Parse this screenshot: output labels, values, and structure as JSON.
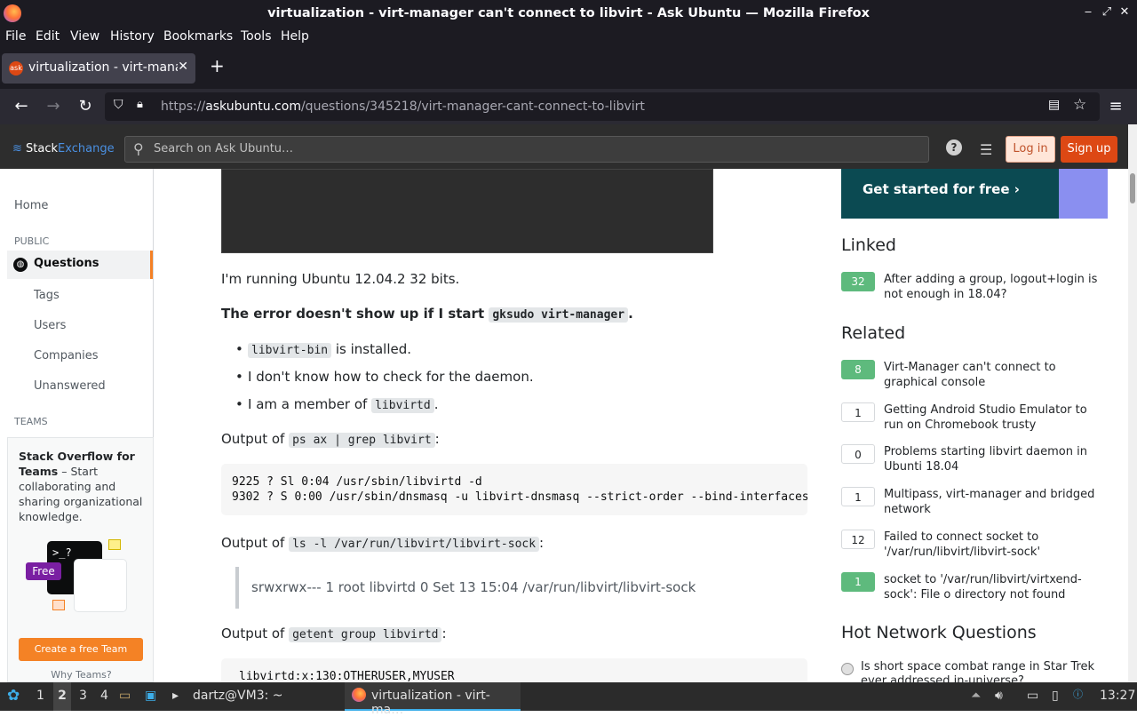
{
  "window": {
    "title": "virtualization - virt-manager can't connect to libvirt - Ask Ubuntu — Mozilla Firefox",
    "controls": [
      "‒",
      "⤢",
      "✕"
    ]
  },
  "menubar": [
    "File",
    "Edit",
    "View",
    "History",
    "Bookmarks",
    "Tools",
    "Help"
  ],
  "tab": {
    "label": "virtualization - virt-manager",
    "favicon": "ask",
    "close": "✕",
    "new_tab": "+"
  },
  "nav": {
    "url_prefix": "https://",
    "url_host": "askubuntu.com",
    "url_path": "/questions/345218/virt-manager-cant-connect-to-libvirt"
  },
  "site_header": {
    "logo_a": "Stack",
    "logo_b": "Exchange",
    "search_placeholder": "Search on Ask Ubuntu…",
    "help": "?",
    "login": "Log in",
    "signup": "Sign up"
  },
  "sidebar": {
    "home": "Home",
    "public": "PUBLIC",
    "questions": "Questions",
    "tags": "Tags",
    "users": "Users",
    "companies": "Companies",
    "unanswered": "Unanswered",
    "teams": "TEAMS",
    "teams_title": "Stack Overflow for Teams",
    "teams_desc": " – Start collaborating and sharing organizational knowledge.",
    "teams_prompt": ">_?",
    "teams_free": "Free",
    "teams_button": "Create a free Team",
    "teams_why": "Why Teams?"
  },
  "post": {
    "p1": "I'm running Ubuntu 12.04.2 32 bits.",
    "p2_text": "The error doesn't show up if I start ",
    "p2_code": "gksudo virt-manager",
    "p2_end": ".",
    "b1_code": "libvirt-bin",
    "b1_text": " is installed.",
    "b2": "I don't know how to check for the daemon.",
    "b3_text": "I am a member of ",
    "b3_code": "libvirtd",
    "b3_end": ".",
    "out1_text": "Output of ",
    "out1_code": "ps ax | grep libvirt",
    "out1_end": ":",
    "pre1_line1": "9225 ? Sl 0:04 /usr/sbin/libvirtd -d",
    "pre1_line2": "9302 ? S 0:00 /usr/sbin/dnsmasq -u libvirt-dnsmasq --strict-order --bind-interfaces",
    "out2_text": "Output of ",
    "out2_code": "ls -l /var/run/libvirt/libvirt-sock",
    "out2_end": ":",
    "quote": "srwxrwx--- 1 root libvirtd 0 Set 13 15:04 /var/run/libvirt/libvirt-sock",
    "out3_text": "Output of ",
    "out3_code": "getent group libvirtd",
    "out3_end": ":",
    "pre2_line1": "libvirtd:x:130:OTHERUSER,MYUSER"
  },
  "right": {
    "ad_text": "Get started for free ›",
    "linked_title": "Linked",
    "linked": [
      {
        "score": "32",
        "title": "After adding a group, logout+login is not enough in 18.04?",
        "accepted": true
      }
    ],
    "related_title": "Related",
    "related": [
      {
        "score": "8",
        "title": "Virt-Manager can't connect to graphical console",
        "accepted": true
      },
      {
        "score": "1",
        "title": "Getting Android Studio Emulator to run on Chromebook trusty",
        "accepted": false
      },
      {
        "score": "0",
        "title": "Problems starting libvirt daemon in Ubunti 18.04",
        "accepted": false
      },
      {
        "score": "1",
        "title": "Multipass, virt-manager and bridged network",
        "accepted": false
      },
      {
        "score": "12",
        "title": "Failed to connect socket to '/var/run/libvirt/libvirt-sock'",
        "accepted": false
      },
      {
        "score": "1",
        "title": "socket to '/var/run/libvirt/virtxend-sock': File o directory not found",
        "accepted": true
      }
    ],
    "hnq_title": "Hot Network Questions",
    "hnq_item": "Is short space combat range in Star Trek ever addressed in-universe?"
  },
  "taskbar": {
    "desktops": [
      "1",
      "2",
      "3",
      "4"
    ],
    "terminal": "dartz@VM3: ~",
    "firefox": "virtualization - virt-ma…",
    "clock": "13:27"
  },
  "colors": {
    "accent": "#dd4814",
    "accepted_green": "#5eba7d",
    "orange": "#f48024"
  }
}
